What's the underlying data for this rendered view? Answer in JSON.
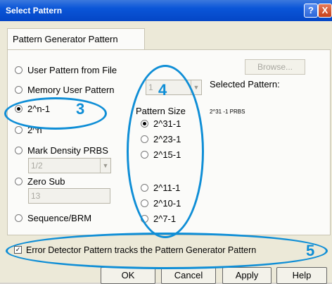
{
  "window": {
    "title": "Select Pattern",
    "help_icon": "?",
    "close_icon": "X"
  },
  "tab": {
    "label": "Pattern Generator Pattern"
  },
  "options": {
    "user_pattern_file": "User Pattern from File",
    "memory_user_pattern": "Memory User Pattern",
    "two_n_minus_1": "2^n-1",
    "two_n": "2^n",
    "mark_density_prbs": "Mark Density PRBS",
    "zero_sub": "Zero Sub",
    "sequence_brm": "Sequence/BRM"
  },
  "browse_button": "Browse...",
  "memory_combo": {
    "value": "1"
  },
  "mark_density_combo": {
    "value": "1/2"
  },
  "zero_sub_field": {
    "value": "13"
  },
  "pattern_size": {
    "label": "Pattern Size",
    "items": [
      "2^31-1",
      "2^23-1",
      "2^15-1",
      "2^11-1",
      "2^10-1",
      "2^7-1"
    ],
    "selected": "2^31-1"
  },
  "selected_pattern": {
    "label": "Selected Pattern:",
    "value": "2^31 -1 PRBS"
  },
  "tracking_checkbox": {
    "label": "Error Detector Pattern tracks the Pattern Generator Pattern",
    "checked": true
  },
  "buttons": {
    "ok": "OK",
    "cancel": "Cancel",
    "apply": "Apply",
    "help": "Help"
  },
  "annotations": [
    "3",
    "4",
    "5"
  ],
  "colors": {
    "titlebar": "#0a55d8",
    "annotation": "#0f8ed6",
    "background": "#ece9d8"
  }
}
